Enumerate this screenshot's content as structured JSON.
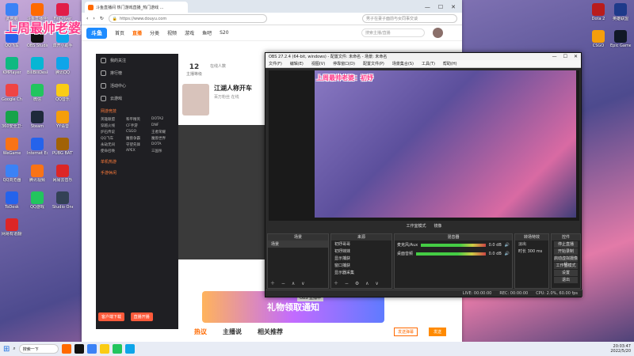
{
  "desktop": {
    "left_icons": [
      {
        "label": "此电脑",
        "color": "#3b82f6"
      },
      {
        "label": "斗鱼直播伴侣",
        "color": "#ff6a00"
      },
      {
        "label": "FinDriver",
        "color": "#e11d48"
      },
      {
        "label": "QQ飞车",
        "color": "#2563eb"
      },
      {
        "label": "OBS Studio",
        "color": "#111111"
      },
      {
        "label": "双开小助手",
        "color": "#0ea5e9"
      },
      {
        "label": "KMPlayer",
        "color": "#10b981"
      },
      {
        "label": "BiliBiliDesk",
        "color": "#06b6d4"
      },
      {
        "label": "腾讯QQ",
        "color": "#0ea5e9"
      },
      {
        "label": "Google Chrome",
        "color": "#ef4444"
      },
      {
        "label": "微信",
        "color": "#22c55e"
      },
      {
        "label": "QQ音乐",
        "color": "#facc15"
      },
      {
        "label": "360安全卫士",
        "color": "#16a34a"
      },
      {
        "label": "Steam",
        "color": "#1e293b"
      },
      {
        "label": "YY语音",
        "color": "#f59e0b"
      },
      {
        "label": "WeGame",
        "color": "#f97316"
      },
      {
        "label": "Internet Explorer",
        "color": "#2563eb"
      },
      {
        "label": "PUBG BATTLEGR...",
        "color": "#a16207"
      },
      {
        "label": "QQ浏览器",
        "color": "#3b82f6"
      },
      {
        "label": "腾讯视频",
        "color": "#f97316"
      },
      {
        "label": "网易云音乐",
        "color": "#dc2626"
      },
      {
        "label": "ToDesk",
        "color": "#2563eb"
      },
      {
        "label": "QQ游戏",
        "color": "#22c55e"
      },
      {
        "label": "Studio One",
        "color": "#334155"
      },
      {
        "label": "网易有道翻译",
        "color": "#dc2626"
      }
    ],
    "overlay_text_top": "上周最帅老婆：初妤",
    "right_icons": [
      {
        "label": "Dota 2",
        "color": "#b91c1c"
      },
      {
        "label": "英雄联盟",
        "color": "#1e3a8a"
      },
      {
        "label": "CSGO",
        "color": "#f59e0b"
      },
      {
        "label": "Epic Games",
        "color": "#111827"
      }
    ]
  },
  "browser": {
    "tab_title": "斗鱼直播间 热门游戏直播_热门游戏 ...",
    "url": "https://www.douyu.com",
    "search_placeholder": "男子在妻子面前与女同事交谈",
    "douyu_nav": [
      "首页",
      "直播",
      "分类",
      "视频",
      "游戏",
      "鱼吧",
      "S20"
    ],
    "douyu_search_placeholder": "搜索主播/直播",
    "sidebar_items": [
      "我的关注",
      "排行榜",
      "活动中心",
      "云游戏"
    ],
    "sidebar_section": "网游竞技",
    "sidebar_grid": [
      "英雄联盟",
      "和平精英",
      "DOTA2",
      "穿越火线",
      "CF手游",
      "DNF",
      "炉石传说",
      "CSGO",
      "王者荣耀",
      "QQ飞车",
      "魔兽争霸",
      "魔兽世界",
      "永劫无间",
      "守望先锋",
      "DOTA",
      "使命召唤",
      "APEX",
      "三国杀"
    ],
    "sidebar_section2": "单机热游",
    "sidebar_section3": "手游休闲",
    "sidebar_buttons": [
      "客户端下载",
      "直播开播"
    ],
    "stats": [
      {
        "value": "12",
        "label": "主播等级"
      },
      {
        "value": "",
        "label": "在线人数"
      }
    ],
    "anchor_name": "江湖人称开车",
    "anchor_sub": "百万粉丝 在线",
    "gift_banner": "礼物领取通知",
    "bottom_tabs": [
      "热议",
      "主播说",
      "相关推荐"
    ],
    "obs_badge": "OBS 直播中",
    "danmu_btn": "发送弹幕",
    "send_btn": "发送"
  },
  "obs": {
    "title": "OBS 27.2.4 (64-bit, windows) - 配置文件: 未命名 - 场景: 未命名",
    "menu": [
      "文件(F)",
      "编辑(E)",
      "视图(V)",
      "停靠窗口(D)",
      "配置文件(P)",
      "场景集合(S)",
      "工具(T)",
      "帮助(H)"
    ],
    "overlay_text": "上周最帅老婆：初妤",
    "mode_labels": [
      "工作室模式",
      "镜像"
    ],
    "docks": {
      "scenes": {
        "header": "场景",
        "rows": [
          "场景"
        ]
      },
      "sources": {
        "header": "来源",
        "rows": [
          "初妤哥哥",
          "初妤妹妹",
          "显示捕获",
          "窗口捕获",
          "显示器采集"
        ]
      },
      "mixer": {
        "header": "混音器",
        "rows": [
          {
            "name": "麦克风/Aux",
            "db": "0.0 dB"
          },
          {
            "name": "桌面音频",
            "db": "0.0 dB"
          }
        ]
      },
      "transitions": {
        "header": "转场特效",
        "rows": [
          "淡出",
          "时长 300 ms"
        ]
      },
      "controls": {
        "header": "控件",
        "buttons": [
          "停止直播",
          "开始录制",
          "启动虚拟摄像机",
          "工作室模式",
          "设置",
          "退出"
        ]
      }
    },
    "status": [
      "LIVE: 00:00:00",
      "REC: 00:00:00",
      "CPU: 2.0%, 60.00 fps"
    ]
  },
  "taskbar": {
    "search_text": "搜索一下",
    "time": "20:03:47",
    "date": "2022/5/20"
  }
}
